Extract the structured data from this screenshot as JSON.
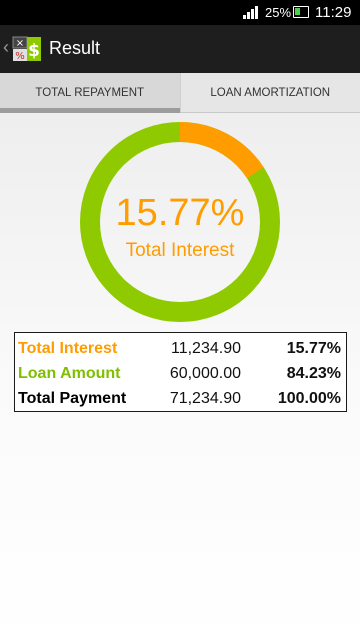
{
  "status_bar": {
    "battery": "25%",
    "time": "11:29"
  },
  "action_bar": {
    "back_icon": "chevron-left-icon",
    "app_icon": "calculator-dollar-icon",
    "title": "Result"
  },
  "tabs": [
    {
      "label": "TOTAL REPAYMENT",
      "active": true
    },
    {
      "label": "LOAN AMORTIZATION",
      "active": false
    }
  ],
  "donut": {
    "percent_label": "15.77%",
    "caption": "Total Interest",
    "interest_fraction": 0.1577,
    "colors": {
      "interest": "#ff9c00",
      "loan": "#8fca00"
    }
  },
  "summary": [
    {
      "name": "Total Interest",
      "amount": "11,234.90",
      "percent": "15.77%",
      "color": "#ff9c00"
    },
    {
      "name": "Loan Amount",
      "amount": "60,000.00",
      "percent": "84.23%",
      "color": "#7fbf00"
    },
    {
      "name": "Total Payment",
      "amount": "71,234.90",
      "percent": "100.00%",
      "color": "#000000"
    }
  ]
}
